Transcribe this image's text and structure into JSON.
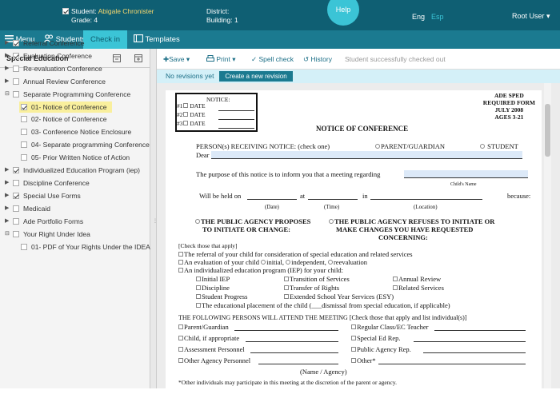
{
  "header": {
    "student_label": "Student:",
    "student_name": "Abigale Chronister",
    "grade_label": "Grade:",
    "grade_value": "4",
    "district_label": "District:",
    "building_label": "Building:",
    "building_value": "1",
    "help": "Help",
    "lang_en": "Eng",
    "lang_es": "Esp",
    "user": "Root User"
  },
  "nav": {
    "menu": "Menu",
    "students": "Students",
    "checkin": "Check in",
    "templates": "Templates"
  },
  "sidebar": {
    "title": "Special Education",
    "items": [
      {
        "label": "Referral Conference",
        "checked": true,
        "toggle": "▶"
      },
      {
        "label": "Evaluation Conference",
        "checked": true,
        "toggle": "▶"
      },
      {
        "label": "Re-evaluation Conference",
        "checked": false,
        "toggle": "▶"
      },
      {
        "label": "Annual Review Conference",
        "checked": false,
        "toggle": "▶"
      },
      {
        "label": "Separate Programming Conference",
        "checked": false,
        "toggle": "⊟"
      },
      {
        "label": "01- Notice of Conference",
        "checked": true,
        "toggle": ""
      },
      {
        "label": "02- Notice of Conference",
        "checked": false,
        "toggle": ""
      },
      {
        "label": "03- Conference Notice Enclosure",
        "checked": false,
        "toggle": ""
      },
      {
        "label": "04- Separate programming Conference De",
        "checked": false,
        "toggle": ""
      },
      {
        "label": "05- Prior Written Notice of Action",
        "checked": false,
        "toggle": ""
      },
      {
        "label": "Individualized Education Program (iep)",
        "checked": true,
        "toggle": "▶"
      },
      {
        "label": "Discipline Conference",
        "checked": false,
        "toggle": "▶"
      },
      {
        "label": "Special Use Forms",
        "checked": true,
        "toggle": "▶"
      },
      {
        "label": "Medicaid",
        "checked": false,
        "toggle": "▶"
      },
      {
        "label": "Ade Portfolio Forms",
        "checked": false,
        "toggle": "▶"
      },
      {
        "label": "Your Right Under Idea",
        "checked": false,
        "toggle": "⊟"
      },
      {
        "label": "01- PDF of Your Rights Under the IDEA",
        "checked": false,
        "toggle": ""
      }
    ]
  },
  "toolbar": {
    "save": "Save",
    "print": "Print",
    "spell": "Spell check",
    "history": "History",
    "status": "Student successfully checked out"
  },
  "revision": {
    "text": "No revisions yet",
    "button": "Create a new revision"
  },
  "doc": {
    "notice_title": "NOTICE:",
    "notice_rows": [
      "#1",
      "#2",
      "#3"
    ],
    "date_label": "DATE",
    "ade1": "ADE SPED",
    "ade2": "REQUIRED FORM",
    "ade3": "JULY 2008",
    "ade4": "AGES 3-21",
    "title": "NOTICE OF CONFERENCE",
    "receiving": "PERSON(s) RECEIVING NOTICE: (check one)",
    "parent": "PARENT/GUARDIAN",
    "student": "STUDENT",
    "dear": "Dear",
    "purpose": "The purpose of this notice is to inform you that a meeting regarding",
    "childs_name": "Child's Name",
    "held": "Will be held on",
    "at": "at",
    "in": "in",
    "because": "because:",
    "date_cap": "(Date)",
    "time_cap": "(Time)",
    "loc_cap": "(Location)",
    "propose1": "THE PUBLIC AGENCY PROPOSES",
    "propose2": "TO INITIATE OR CHANGE:",
    "refuse1": "THE PUBLIC AGENCY REFUSES TO INITIATE OR",
    "refuse2": "MAKE CHANGES YOU HAVE REQUESTED",
    "refuse3": "CONCERNING:",
    "check_apply": "[Check those that apply]",
    "ref1": "The referral of your child for consideration of special education and related services",
    "eval_pre": "An evaluation of your child",
    "initial": "initial,",
    "independent": "independent,",
    "reeval": "reevaluation",
    "iep": "An individualized education program (IEP) for your child:",
    "opts": [
      "Initial IEP",
      "Transition of Services",
      "Annual Review",
      "Discipline",
      "Transfer of Rights",
      "Related Services",
      "Student Progress",
      "Extended School Year Services (ESY)"
    ],
    "placement": "The educational placement of the child (___dismissal from special education, if applicable)",
    "persons": "THE FOLLOWING PERSONS WILL ATTEND THE MEETING",
    "persons_check": "[Check those that apply and list individual(s)]",
    "att": [
      "Parent/Guardian",
      "Regular Class/EC Teacher",
      "Child, if appropriate",
      "Special Ed Rep.",
      "Assessment Personnel",
      "Public Agency Rep.",
      "Other Agency Personnel",
      "Other*"
    ],
    "name_agency": "(Name / Agency)",
    "footnote": "*Other individuals may participate in this meeting at the discretion of the parent or agency."
  }
}
